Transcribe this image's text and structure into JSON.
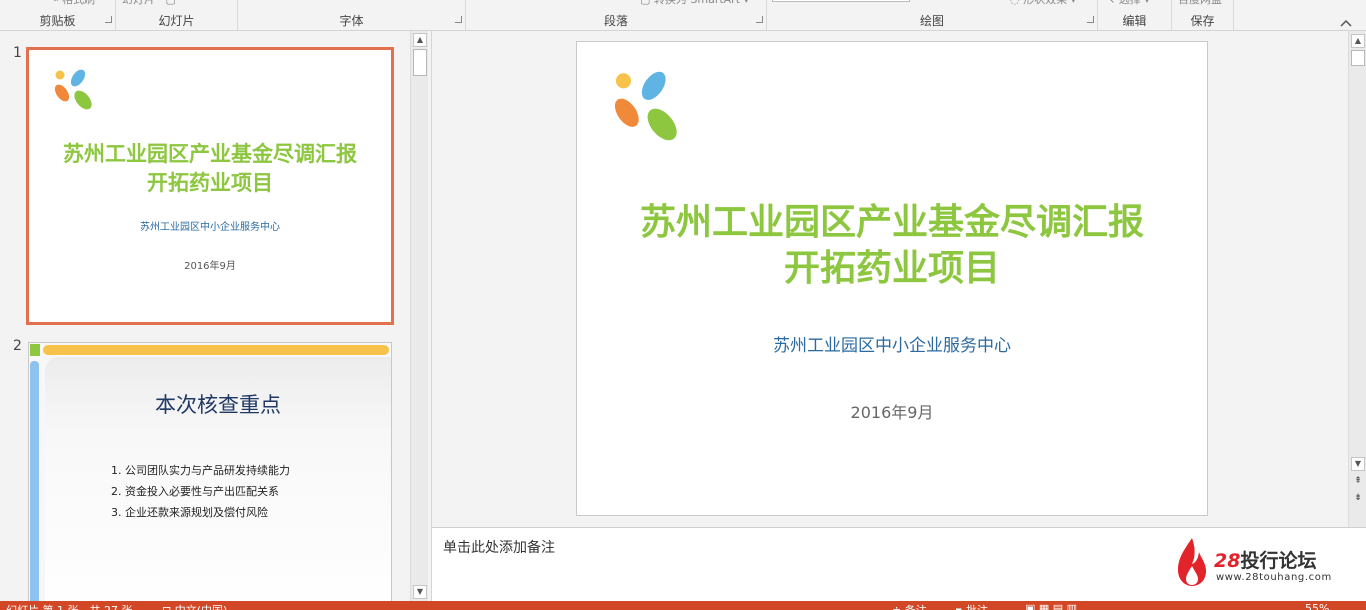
{
  "ribbon": {
    "groups": {
      "clipboard": "剪贴板",
      "slides": "幻灯片",
      "font": "字体",
      "paragraph": "段落",
      "drawing": "绘图",
      "editing": "编辑",
      "save": "保存"
    }
  },
  "thumbnails": [
    {
      "number": "1",
      "title_line1": "苏州工业园区产业基金尽调汇报",
      "title_line2": "开拓药业项目",
      "subtitle": "苏州工业园区中小企业服务中心",
      "date": "2016年9月"
    },
    {
      "number": "2",
      "title": "本次核查重点",
      "items": [
        "1.  公司团队实力与产品研发持续能力",
        "2.  资金投入必要性与产出匹配关系",
        "3.  企业还款来源规划及偿付风险"
      ]
    }
  ],
  "slide": {
    "title_line1": "苏州工业园区产业基金尽调汇报",
    "title_line2": "开拓药业项目",
    "subtitle": "苏州工业园区中小企业服务中心",
    "date": "2016年9月"
  },
  "notes": {
    "placeholder": "单击此处添加备注"
  },
  "watermark": {
    "number": "28",
    "name": "投行论坛",
    "url": "www.28touhang.com"
  },
  "colors": {
    "accent": "#d24726",
    "title_green": "#8dc63f",
    "subtitle_blue": "#2a6aa0",
    "thumb_selected_border": "#e26f4d"
  }
}
